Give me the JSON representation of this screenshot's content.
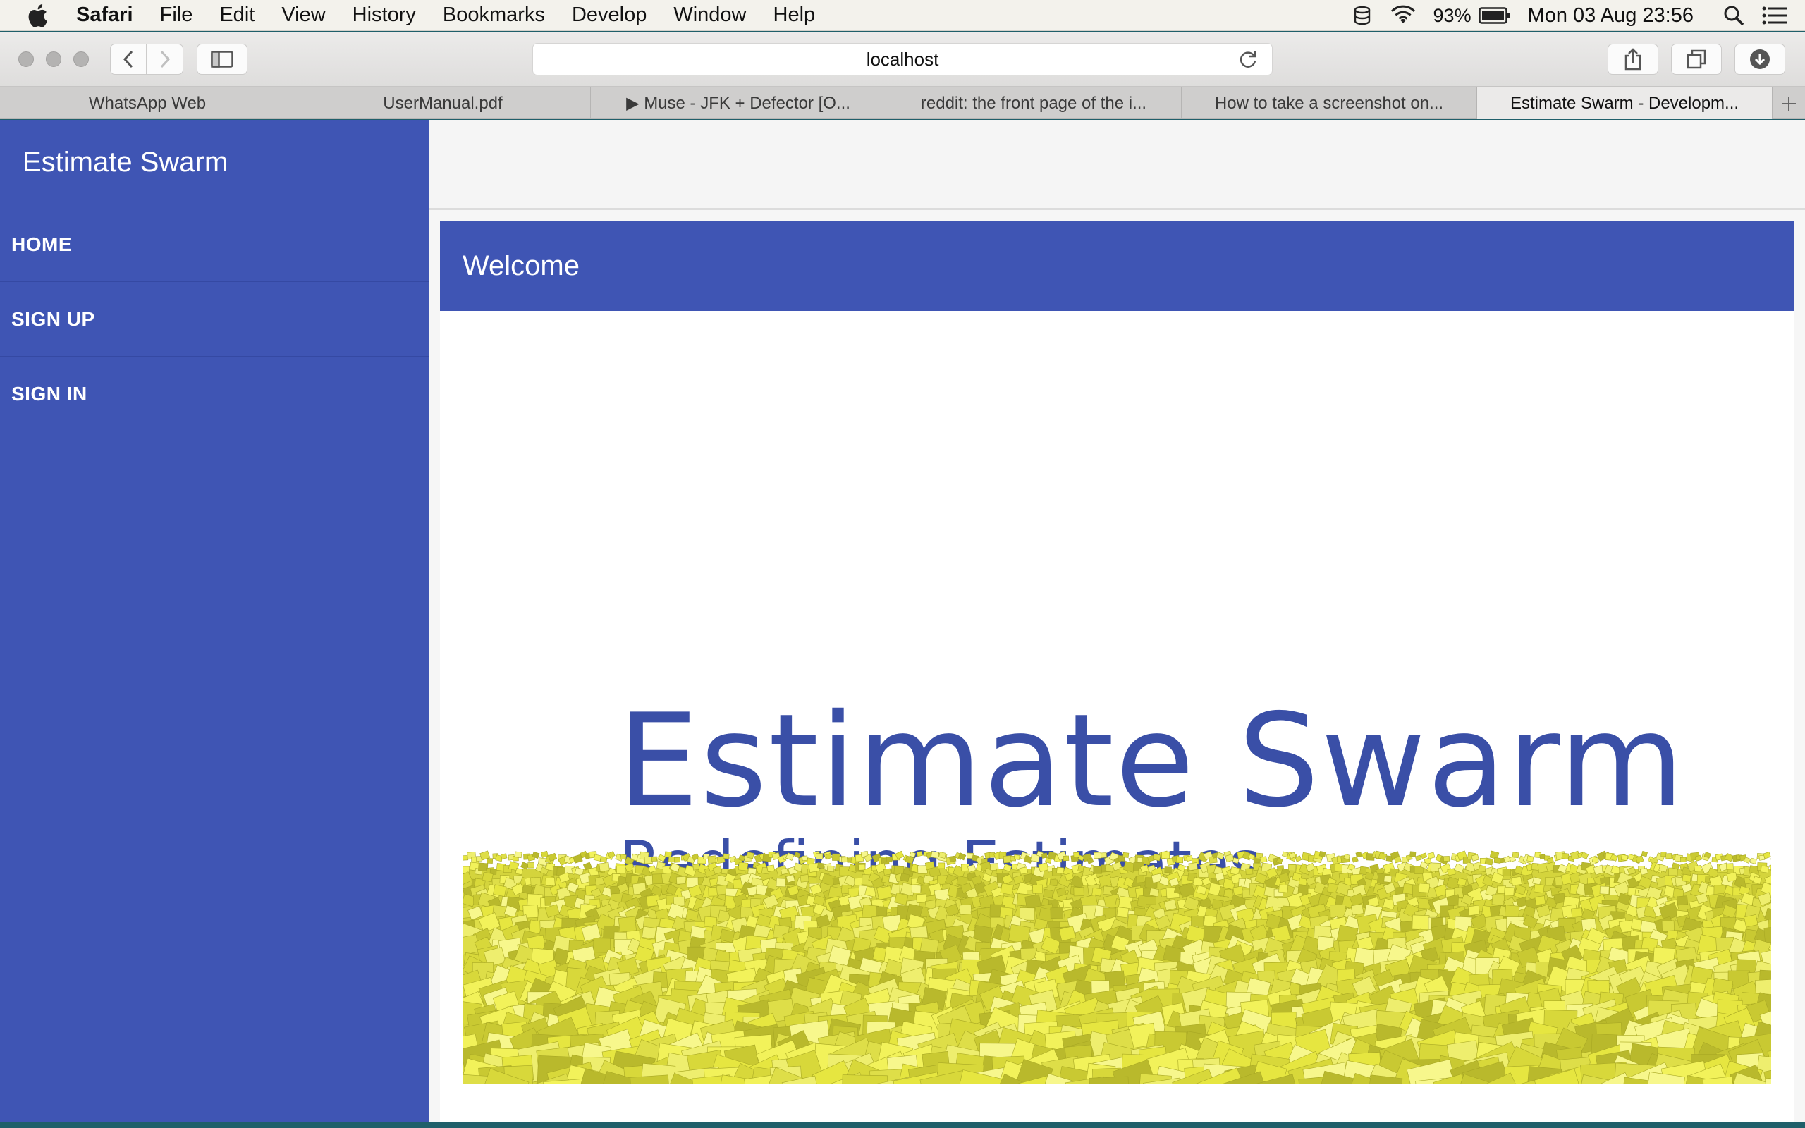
{
  "menubar": {
    "app_name": "Safari",
    "items": [
      "File",
      "Edit",
      "View",
      "History",
      "Bookmarks",
      "Develop",
      "Window",
      "Help"
    ],
    "battery_percent": "93%",
    "clock": "Mon 03 Aug  23:56"
  },
  "toolbar": {
    "url": "localhost"
  },
  "tabs": [
    {
      "label": "WhatsApp Web"
    },
    {
      "label": "UserManual.pdf"
    },
    {
      "label": "▶ Muse - JFK + Defector [O..."
    },
    {
      "label": "reddit: the front page of the i..."
    },
    {
      "label": "How to take a screenshot on..."
    },
    {
      "label": "Estimate Swarm - Developm..."
    }
  ],
  "sidebar": {
    "brand": "Estimate Swarm",
    "items": [
      {
        "label": "HOME"
      },
      {
        "label": "SIGN UP"
      },
      {
        "label": "SIGN IN"
      }
    ]
  },
  "main": {
    "card_title": "Welcome",
    "hero_title": "Estimate Swarm",
    "hero_subtitle": "Redefining Estimates"
  },
  "colors": {
    "primary": "#3f55b4",
    "hero_text": "#3a4fa7",
    "swarm_yellow": "#e8e84a"
  }
}
